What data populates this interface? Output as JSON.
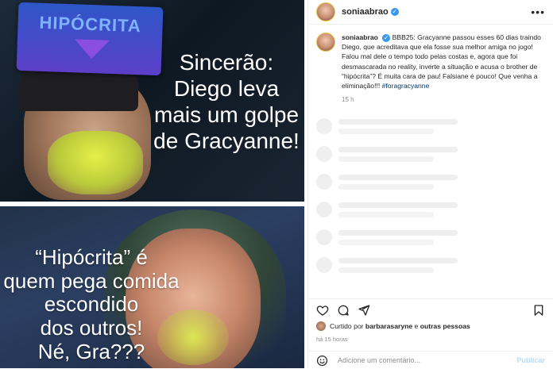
{
  "media": {
    "top_panel": {
      "sign_text": "HIPÓCRITA",
      "caption_lines": [
        "Sincerão:",
        "Diego leva",
        "mais um golpe",
        "de Gracyanne!"
      ]
    },
    "bottom_panel": {
      "caption_lines": [
        "“Hipócrita” é",
        "quem pega comida",
        "escondido",
        "dos outros!",
        "Né, Gra???"
      ]
    }
  },
  "header": {
    "username": "soniaabrao",
    "verified_mark": "✓",
    "more_label": "•••"
  },
  "caption": {
    "username": "soniaabrao",
    "verified_mark": "✓",
    "body": "BBB25: Gracyanne passou esses 60 dias traindo Diego, que acreditava que ela fosse sua melhor amiga no jogo! Falou mal dele o tempo todo pelas costas e, agora que foi desmascarada no reality, inverte a situação e acusa o brother de “hipócrita”? É muita cara de pau! Falsiane é pouco! Que venha a eliminação!!!",
    "hashtag": "#foragracyanne",
    "time": "15 h"
  },
  "likes": {
    "prefix": "Curtido por",
    "user": "barbarasaryne",
    "conjunction": "e",
    "others": "outras pessoas"
  },
  "posted_ago": "há 15 horas",
  "comment": {
    "placeholder": "Adicione um comentário...",
    "post_label": "Publicar"
  },
  "icons": [
    "heart-icon",
    "comment-icon",
    "share-icon",
    "bookmark-icon",
    "emoji-icon",
    "more-icon",
    "verified-icon"
  ],
  "colors": {
    "verified_blue": "#3897f0",
    "hashtag": "#00376b",
    "muted": "#8e8e8e",
    "post_button": "#b2dffc"
  }
}
